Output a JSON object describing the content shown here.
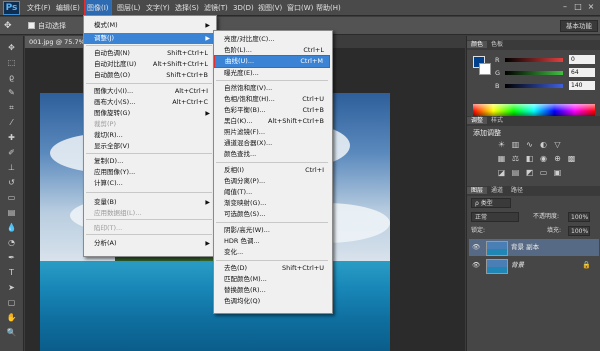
{
  "app": {
    "logo": "Ps"
  },
  "menubar": {
    "items": [
      "文件(F)",
      "编辑(E)",
      "图像(I)",
      "图层(L)",
      "文字(Y)",
      "选择(S)",
      "滤镜(T)",
      "3D(D)",
      "视图(V)",
      "窗口(W)",
      "帮助(H)"
    ],
    "active_index": 2,
    "window_controls": [
      "–",
      "□",
      "×"
    ]
  },
  "options_bar": {
    "auto_select_label": "自动选择",
    "essentials": "基本功能"
  },
  "document": {
    "tab_label": "001.jpg @ 75.7%"
  },
  "image_menu": {
    "items": [
      {
        "label": "模式(M)",
        "shortcut": "",
        "submenu": true
      },
      {
        "label": "调整(J)",
        "shortcut": "",
        "submenu": true,
        "state": "highlight"
      },
      {
        "label": "自动色调(N)",
        "shortcut": "Shift+Ctrl+L"
      },
      {
        "label": "自动对比度(U)",
        "shortcut": "Alt+Shift+Ctrl+L"
      },
      {
        "label": "自动颜色(O)",
        "shortcut": "Shift+Ctrl+B"
      },
      {
        "label": "图像大小(I)...",
        "shortcut": "Alt+Ctrl+I"
      },
      {
        "label": "画布大小(S)...",
        "shortcut": "Alt+Ctrl+C"
      },
      {
        "label": "图像旋转(G)",
        "shortcut": "",
        "submenu": true
      },
      {
        "label": "裁剪(P)",
        "shortcut": "",
        "disabled": true
      },
      {
        "label": "裁切(R)...",
        "shortcut": ""
      },
      {
        "label": "显示全部(V)",
        "shortcut": ""
      },
      {
        "label": "复制(D)...",
        "shortcut": ""
      },
      {
        "label": "应用图像(Y)...",
        "shortcut": ""
      },
      {
        "label": "计算(C)...",
        "shortcut": ""
      },
      {
        "label": "变量(B)",
        "shortcut": "",
        "submenu": true
      },
      {
        "label": "应用数据组(L)...",
        "shortcut": "",
        "disabled": true
      },
      {
        "label": "陷印(T)...",
        "shortcut": "",
        "disabled": true
      },
      {
        "label": "分析(A)",
        "shortcut": "",
        "submenu": true
      }
    ]
  },
  "adjust_menu": {
    "items": [
      {
        "label": "亮度/对比度(C)...",
        "shortcut": ""
      },
      {
        "label": "色阶(L)...",
        "shortcut": "Ctrl+L"
      },
      {
        "label": "曲线(U)...",
        "shortcut": "Ctrl+M",
        "state": "boxed"
      },
      {
        "label": "曝光度(E)...",
        "shortcut": ""
      },
      {
        "label": "自然饱和度(V)...",
        "shortcut": ""
      },
      {
        "label": "色相/饱和度(H)...",
        "shortcut": "Ctrl+U"
      },
      {
        "label": "色彩平衡(B)...",
        "shortcut": "Ctrl+B"
      },
      {
        "label": "黑白(K)...",
        "shortcut": "Alt+Shift+Ctrl+B"
      },
      {
        "label": "照片滤镜(F)...",
        "shortcut": ""
      },
      {
        "label": "通道混合器(X)...",
        "shortcut": ""
      },
      {
        "label": "颜色查找...",
        "shortcut": ""
      },
      {
        "label": "反相(I)",
        "shortcut": "Ctrl+I"
      },
      {
        "label": "色调分离(P)...",
        "shortcut": ""
      },
      {
        "label": "阈值(T)...",
        "shortcut": ""
      },
      {
        "label": "渐变映射(G)...",
        "shortcut": ""
      },
      {
        "label": "可选颜色(S)...",
        "shortcut": ""
      },
      {
        "label": "阴影/高光(W)...",
        "shortcut": ""
      },
      {
        "label": "HDR 色调...",
        "shortcut": ""
      },
      {
        "label": "变化...",
        "shortcut": ""
      },
      {
        "label": "去色(D)",
        "shortcut": "Shift+Ctrl+U"
      },
      {
        "label": "匹配颜色(M)...",
        "shortcut": ""
      },
      {
        "label": "替换颜色(R)...",
        "shortcut": ""
      },
      {
        "label": "色调均化(Q)",
        "shortcut": ""
      }
    ]
  },
  "color_panel": {
    "tabs": [
      "颜色",
      "色板"
    ],
    "rows": [
      {
        "label": "R",
        "value": "0",
        "color": "#e04040"
      },
      {
        "label": "G",
        "value": "64",
        "color": "#40c040"
      },
      {
        "label": "B",
        "value": "140",
        "color": "#4060e0"
      }
    ],
    "foreground": "#00408c"
  },
  "adjustments_panel": {
    "tabs": [
      "调整",
      "样式"
    ],
    "title": "添加调整"
  },
  "layers_panel": {
    "tabs": [
      "图层",
      "通道",
      "路径"
    ],
    "kind_label": "ρ 类型",
    "blend_mode": "正常",
    "opacity_label": "不透明度:",
    "opacity_value": "100%",
    "lock_label": "锁定:",
    "fill_label": "填充:",
    "fill_value": "100%",
    "layers": [
      {
        "name": "背景 副本",
        "selected": true
      },
      {
        "name": "背景",
        "selected": false
      }
    ]
  }
}
